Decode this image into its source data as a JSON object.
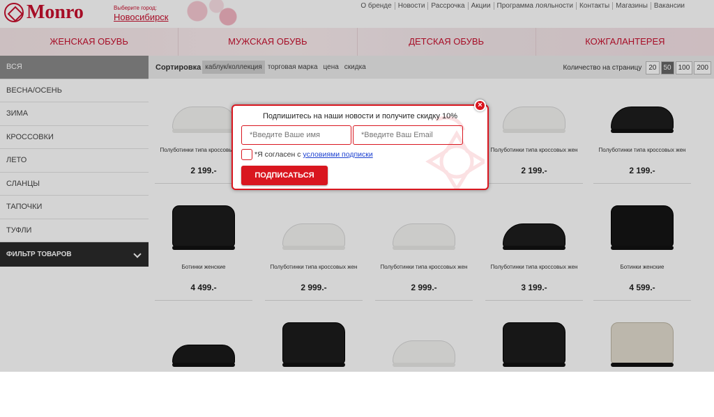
{
  "header": {
    "logo_text": "Monro",
    "city_label": "Выберите город:",
    "city": "Новосибирск",
    "links": [
      "О бренде",
      "Новости",
      "Рассрочка",
      "Акции",
      "Программа лояльности",
      "Контакты",
      "Магазины",
      "Вакансии"
    ]
  },
  "categories": [
    "ЖЕНСКАЯ ОБУВЬ",
    "МУЖСКАЯ ОБУВЬ",
    "ДЕТСКАЯ ОБУВЬ",
    "КОЖГАЛАНТЕРЕЯ"
  ],
  "sidebar": {
    "items": [
      "ВСЯ",
      "ВЕСНА/ОСЕНЬ",
      "ЗИМА",
      "КРОССОВКИ",
      "ЛЕТО",
      "СЛАНЦЫ",
      "ТАПОЧКИ",
      "ТУФЛИ"
    ],
    "active_index": 0,
    "filter_label": "ФИЛЬТР ТОВАРОВ"
  },
  "sort": {
    "label": "Сортировка",
    "options": [
      "каблук/коллекция",
      "торговая марка",
      "цена",
      "скидка"
    ],
    "selected": "каблук/коллекция",
    "per_page_label": "Количество на страницу",
    "per_page_options": [
      "20",
      "50",
      "100",
      "200"
    ],
    "per_page_selected": "50"
  },
  "products": [
    {
      "name": "Полуботинки типа кроссовых жен",
      "price": "2 199.-",
      "icon": "white-sneaker-icon"
    },
    {
      "name": "",
      "price": "",
      "icon": "white-sneaker-icon"
    },
    {
      "name": "",
      "price": "",
      "icon": "white-sneaker-icon"
    },
    {
      "name": "Полуботинки типа кроссовых жен",
      "price": "2 199.-",
      "icon": "white-sneaker-icon"
    },
    {
      "name": "Полуботинки типа кроссовых жен",
      "price": "2 199.-",
      "icon": "black-sneaker-icon"
    },
    {
      "name": "Ботинки женские",
      "price": "4 499.-",
      "icon": "black-boot-icon"
    },
    {
      "name": "Полуботинки типа кроссовых жен",
      "price": "2 999.-",
      "icon": "white-sneaker-icon"
    },
    {
      "name": "Полуботинки типа кроссовых жен",
      "price": "2 999.-",
      "icon": "white-sneaker-icon"
    },
    {
      "name": "Полуботинки типа кроссовых жен",
      "price": "3 199.-",
      "icon": "black-sneaker-icon"
    },
    {
      "name": "Ботинки женские",
      "price": "4 599.-",
      "icon": "black-chelsea-icon"
    },
    {
      "name": "",
      "price": "",
      "icon": "black-shoe-icon"
    },
    {
      "name": "",
      "price": "",
      "icon": "black-boot-icon"
    },
    {
      "name": "",
      "price": "",
      "icon": "white-sneaker-icon"
    },
    {
      "name": "",
      "price": "",
      "icon": "black-boot-icon"
    },
    {
      "name": "",
      "price": "",
      "icon": "beige-boot-icon"
    }
  ],
  "modal": {
    "title": "Подпишитесь на наши новости и получите скидку 10%",
    "name_placeholder": "*Введите Ваше имя",
    "email_placeholder": "*Введите Ваш Email",
    "agree_text": "*Я согласен с",
    "agree_link": "условиями подписки",
    "submit_label": "ПОДПИСАТЬСЯ",
    "close_glyph": "×"
  },
  "colors": {
    "accent": "#d9161f",
    "brand": "#c8102e"
  }
}
